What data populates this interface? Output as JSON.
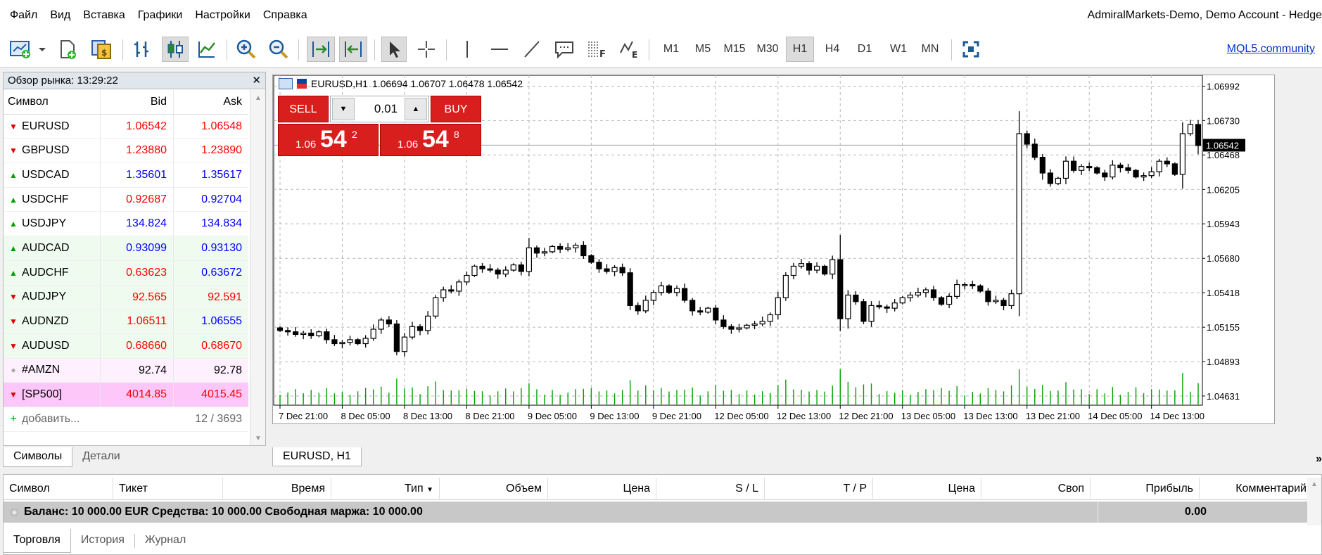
{
  "menu": [
    "Файл",
    "Вид",
    "Вставка",
    "Графики",
    "Настройки",
    "Справка"
  ],
  "window_title": "AdmiralMarkets-Demo, Demo Account - Hedge",
  "toolbar": {
    "timeframes": [
      "M1",
      "M5",
      "M15",
      "M30",
      "H1",
      "H4",
      "D1",
      "W1",
      "MN"
    ],
    "active_timeframe": "H1",
    "community_link": "MQL5.community"
  },
  "market_watch": {
    "title": "Обзор рынка: 13:29:22",
    "col_symbol": "Символ",
    "col_bid": "Bid",
    "col_ask": "Ask",
    "rows": [
      {
        "symbol": "EURUSD",
        "bid": "1.06542",
        "ask": "1.06548",
        "dir": "down",
        "bid_color": "red",
        "ask_color": "red",
        "bg": "white"
      },
      {
        "symbol": "GBPUSD",
        "bid": "1.23880",
        "ask": "1.23890",
        "dir": "down",
        "bid_color": "red",
        "ask_color": "red",
        "bg": "white"
      },
      {
        "symbol": "USDCAD",
        "bid": "1.35601",
        "ask": "1.35617",
        "dir": "up",
        "bid_color": "blue",
        "ask_color": "blue",
        "bg": "white"
      },
      {
        "symbol": "USDCHF",
        "bid": "0.92687",
        "ask": "0.92704",
        "dir": "up",
        "bid_color": "red",
        "ask_color": "blue",
        "bg": "white"
      },
      {
        "symbol": "USDJPY",
        "bid": "134.824",
        "ask": "134.834",
        "dir": "up",
        "bid_color": "blue",
        "ask_color": "blue",
        "bg": "white"
      },
      {
        "symbol": "AUDCAD",
        "bid": "0.93099",
        "ask": "0.93130",
        "dir": "up",
        "bid_color": "blue",
        "ask_color": "blue",
        "bg": "green"
      },
      {
        "symbol": "AUDCHF",
        "bid": "0.63623",
        "ask": "0.63672",
        "dir": "up",
        "bid_color": "red",
        "ask_color": "blue",
        "bg": "green"
      },
      {
        "symbol": "AUDJPY",
        "bid": "92.565",
        "ask": "92.591",
        "dir": "down",
        "bid_color": "red",
        "ask_color": "red",
        "bg": "green"
      },
      {
        "symbol": "AUDNZD",
        "bid": "1.06511",
        "ask": "1.06555",
        "dir": "down",
        "bid_color": "red",
        "ask_color": "blue",
        "bg": "green"
      },
      {
        "symbol": "AUDUSD",
        "bid": "0.68660",
        "ask": "0.68670",
        "dir": "down",
        "bid_color": "red",
        "ask_color": "red",
        "bg": "green"
      },
      {
        "symbol": "#AMZN",
        "bid": "92.74",
        "ask": "92.78",
        "dir": "none",
        "bid_color": "black",
        "ask_color": "black",
        "bg": "pink"
      },
      {
        "symbol": "[SP500]",
        "bid": "4014.85",
        "ask": "4015.45",
        "dir": "down",
        "bid_color": "red",
        "ask_color": "red",
        "bg": "magenta"
      }
    ],
    "add_label": "добавить...",
    "count": "12 / 3693"
  },
  "market_tabs": [
    "Символы",
    "Детали"
  ],
  "chart": {
    "symbol_tf": "EURUSD,H1",
    "ohlc": "1.06694 1.06707 1.06478 1.06542",
    "tab_label": "EURUSD, H1",
    "current_price": "1.06542",
    "one_click": {
      "sell_label": "SELL",
      "buy_label": "BUY",
      "volume": "0.01",
      "sell_prefix": "1.06",
      "sell_big": "54",
      "sell_sup": "2",
      "buy_prefix": "1.06",
      "buy_big": "54",
      "buy_sup": "8"
    }
  },
  "chart_data": {
    "type": "candlestick",
    "y_ticks": [
      "1.06992",
      "1.06730",
      "1.06468",
      "1.06205",
      "1.05943",
      "1.05680",
      "1.05418",
      "1.05155",
      "1.04893",
      "1.04631"
    ],
    "ylim": [
      1.04561,
      1.07075
    ],
    "x_ticks": [
      "7 Dec 21:00",
      "8 Dec 05:00",
      "8 Dec 13:00",
      "8 Dec 21:00",
      "9 Dec 05:00",
      "9 Dec 13:00",
      "9 Dec 21:00",
      "12 Dec 05:00",
      "12 Dec 13:00",
      "12 Dec 21:00",
      "13 Dec 05:00",
      "13 Dec 13:00",
      "13 Dec 21:00",
      "14 Dec 05:00",
      "14 Dec 13:00"
    ],
    "grid": true,
    "candle_color": "#000000",
    "volume_color": "#00a000",
    "closes": [
      1.0513,
      1.0512,
      1.051,
      1.0511,
      1.0509,
      1.0512,
      1.0506,
      1.0503,
      1.0504,
      1.0506,
      1.0503,
      1.0507,
      1.0514,
      1.0521,
      1.0518,
      1.0497,
      1.0508,
      1.0516,
      1.0513,
      1.0524,
      1.0538,
      1.0544,
      1.0543,
      1.055,
      1.0555,
      1.0562,
      1.056,
      1.0559,
      1.0556,
      1.0559,
      1.0563,
      1.0558,
      1.0576,
      1.0572,
      1.0573,
      1.0577,
      1.0575,
      1.0576,
      1.0578,
      1.057,
      1.0565,
      1.056,
      1.0558,
      1.0561,
      1.0557,
      1.0532,
      1.0528,
      1.0536,
      1.0542,
      1.0547,
      1.0542,
      1.0545,
      1.0536,
      1.0528,
      1.0527,
      1.053,
      1.0521,
      1.0516,
      1.0514,
      1.0515,
      1.0517,
      1.0518,
      1.052,
      1.0525,
      1.0538,
      1.0555,
      1.0562,
      1.0564,
      1.0559,
      1.0562,
      1.0556,
      1.0567,
      1.0522,
      1.054,
      1.0535,
      1.052,
      1.0532,
      1.0531,
      1.053,
      1.0534,
      1.0538,
      1.054,
      1.0542,
      1.0544,
      1.0538,
      1.0533,
      1.0539,
      1.0548,
      1.0548,
      1.0547,
      1.0543,
      1.0535,
      1.0536,
      1.0532,
      1.0541,
      1.0663,
      1.0655,
      1.0645,
      1.0633,
      1.0625,
      1.0629,
      1.0642,
      1.0635,
      1.0638,
      1.0637,
      1.0633,
      1.063,
      1.0639,
      1.0637,
      1.0635,
      1.063,
      1.0631,
      1.0634,
      1.0642,
      1.064,
      1.0632,
      1.0663,
      1.067,
      1.0654
    ]
  },
  "terminal": {
    "columns": [
      "Символ",
      "Тикет",
      "Время",
      "Тип",
      "Объем",
      "Цена",
      "S / L",
      "T / P",
      "Цена",
      "Своп",
      "Прибыль",
      "Комментарий"
    ],
    "balance_text": "Баланс: 10 000.00 EUR  Средства: 10 000.00  Свободная маржа: 10 000.00",
    "profit": "0.00",
    "tabs": [
      "Торговля",
      "История",
      "Журнал"
    ]
  }
}
